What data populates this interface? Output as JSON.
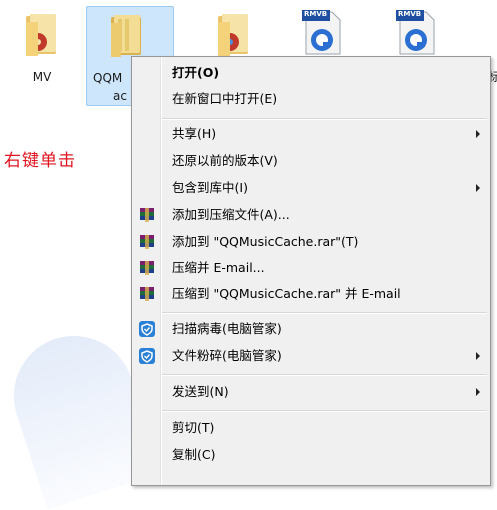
{
  "desktop": {
    "items": [
      {
        "label": "MV"
      },
      {
        "label": "QQM",
        "sub": "ac"
      },
      {
        "label": ""
      },
      {
        "badge": "RMVB"
      },
      {
        "badge": "RMVB"
      }
    ],
    "clipped_text": "标"
  },
  "annotation": "右键单击",
  "menu": {
    "items": [
      {
        "label": "打开(O)"
      },
      {
        "label": "在新窗口中打开(E)"
      },
      {
        "label": "共享(H)"
      },
      {
        "label": "还原以前的版本(V)"
      },
      {
        "label": "包含到库中(I)"
      },
      {
        "label": "添加到压缩文件(A)..."
      },
      {
        "label": "添加到 \"QQMusicCache.rar\"(T)"
      },
      {
        "label": "压缩并 E-mail..."
      },
      {
        "label": "压缩到 \"QQMusicCache.rar\" 并 E-mail"
      },
      {
        "label": "扫描病毒(电脑管家)"
      },
      {
        "label": "文件粉碎(电脑管家)"
      },
      {
        "label": "发送到(N)"
      },
      {
        "label": "剪切(T)"
      },
      {
        "label": "复制(C)"
      }
    ]
  },
  "colors": {
    "annotation": "#e0141e",
    "selection": "#cde6fb",
    "menu_bg": "#f0f0f0",
    "shield_blue": "#2a7fd6"
  }
}
